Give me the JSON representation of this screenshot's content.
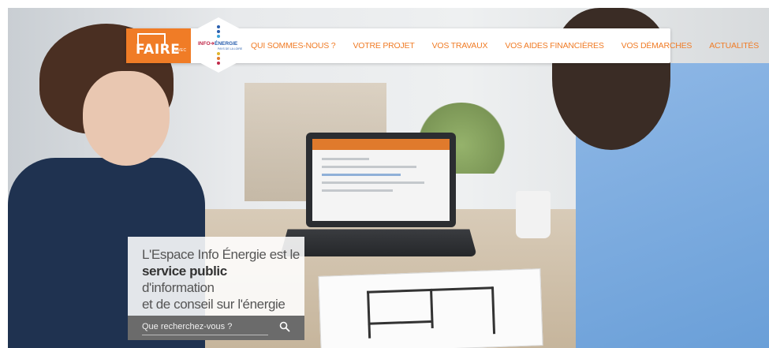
{
  "colors": {
    "brand": "#f07c26",
    "nav_background": "#ffffff",
    "card_text": "#555555",
    "search_bar": "#6b6b6b"
  },
  "logos": {
    "faire": {
      "word": "FAIRE",
      "tagline": "AVEC"
    },
    "info_energie": {
      "title_a": "INFO",
      "title_b": "ÉNERGIE",
      "subtitle": "PAYS DE LA LOIRE"
    }
  },
  "nav": {
    "items": [
      {
        "label": "QUI SOMMES-NOUS ?"
      },
      {
        "label": "VOTRE PROJET"
      },
      {
        "label": "VOS TRAVAUX"
      },
      {
        "label": "VOS AIDES FINANCIÈRES"
      },
      {
        "label": "VOS DÉMARCHES"
      },
      {
        "label": "ACTUALITÉS"
      }
    ]
  },
  "hero": {
    "line_1": "L'Espace Info Énergie est le",
    "emphasis": "service public",
    "line_2_rest": " d'information",
    "line_3": "et de conseil sur l'énergie"
  },
  "search": {
    "placeholder": "Que recherchez-vous ?",
    "icon": "search-icon"
  }
}
